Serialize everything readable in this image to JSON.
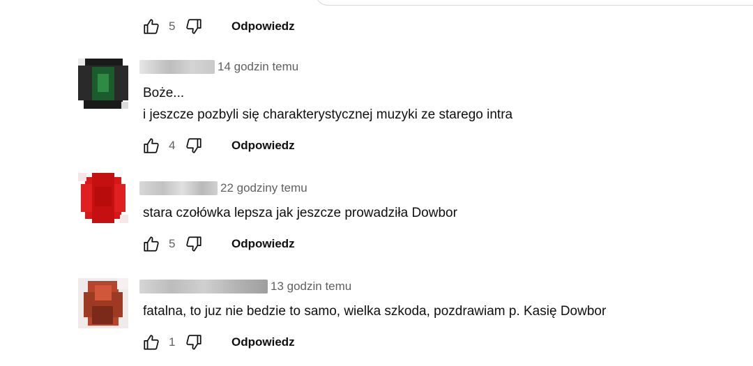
{
  "reply_label": "Odpowiedz",
  "top_actions": {
    "likes": "5"
  },
  "comments": [
    {
      "time": "14 godzin temu",
      "lines": [
        "Boże...",
        "i jeszcze pozbyli się charakterystycznej muzyki ze starego intra"
      ],
      "likes": "4",
      "avatar_color": "#1e6b33"
    },
    {
      "time": "22 godziny temu",
      "lines": [
        "stara czołówka lepsza jak jeszcze prowadziła Dowbor"
      ],
      "likes": "5",
      "avatar_color": "#d21414"
    },
    {
      "time": "13 godzin temu",
      "lines": [
        "fatalna, to juz nie bedzie to samo, wielka szkoda, pozdrawiam p. Kasię Dowbor"
      ],
      "likes": "1",
      "avatar_color": "#a83a22"
    }
  ],
  "icons": {
    "like": "thumbs-up-icon",
    "dislike": "thumbs-down-icon"
  }
}
